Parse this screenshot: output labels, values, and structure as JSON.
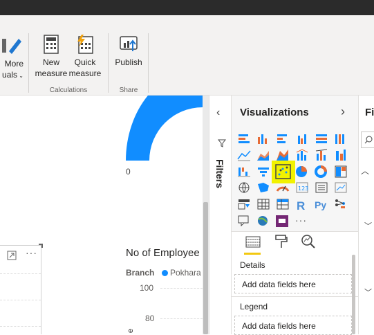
{
  "ribbon": {
    "more_visuals_line1": "More",
    "more_visuals_line2": "uals",
    "new_measure_line1": "New",
    "new_measure_line2": "measure",
    "quick_measure_line1": "Quick",
    "quick_measure_line2": "measure",
    "publish_label": "Publish",
    "calculations_group": "Calculations",
    "share_group": "Share"
  },
  "canvas": {
    "gauge_min_label": "0",
    "chart_title": "No of Employee",
    "legend_field": "Branch",
    "legend_item": "Pokhara",
    "y_ticks": [
      "100",
      "80"
    ],
    "axis_char": "e",
    "more_options": "···"
  },
  "filters_pane": {
    "label": "Filters"
  },
  "visualizations": {
    "title": "Visualizations",
    "more_glyph": "···",
    "details_label": "Details",
    "details_placeholder": "Add data fields here",
    "legend_label": "Legend",
    "legend_placeholder": "Add data fields here"
  },
  "fields_pane": {
    "title": "Fi"
  },
  "colors": {
    "accent_blue": "#118dff",
    "highlight": "#f2f200",
    "selected_tab": "#f2c811"
  }
}
